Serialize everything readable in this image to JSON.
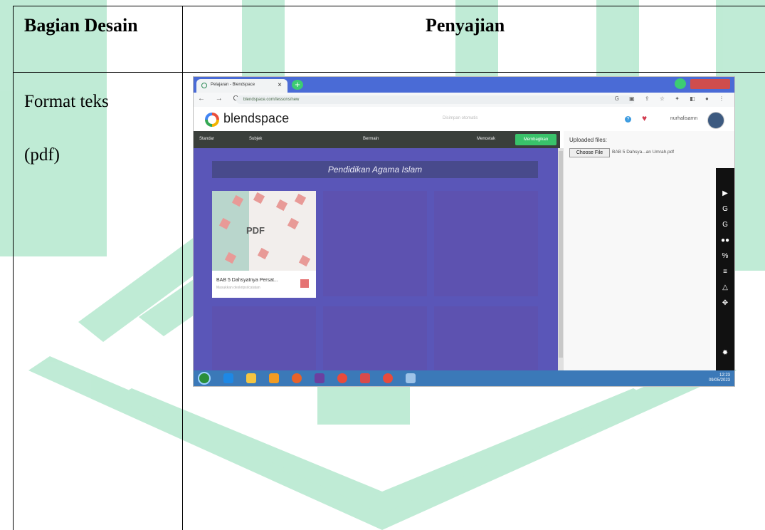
{
  "table": {
    "headers": [
      "Bagian Desain",
      "Penyajian"
    ],
    "row": {
      "col1_line1": "Format teks",
      "col1_line2": "(pdf)"
    }
  },
  "screenshot": {
    "browser": {
      "tab_title": "Pelajaran - Blendspace",
      "url": "blendspace.com/lessons/new",
      "nav_icons": "← → C"
    },
    "blendspace": {
      "logo": "blendspace",
      "saved_status": "Disimpan otomatis",
      "username": "nurhalisamn",
      "toolbar": {
        "standar": "Standar",
        "subjek": "Subjek",
        "bermain": "Bermain",
        "mencetak": "Mencetak",
        "membagikan": "Membagikan"
      },
      "lesson_title": "Pendidikan Agama Islam",
      "card": {
        "badge": "PDF",
        "title": "BAB 5 Dahsyatnya Persat...",
        "subtitle": "Masukkan deskripsi/catatan"
      },
      "upload": {
        "label": "Uploaded files:",
        "button": "Choose File",
        "file": "BAB 5 Dahsya...an Umrah.pdf"
      }
    },
    "taskbar": {
      "time": "12:23",
      "date": "09/05/2023"
    }
  },
  "colors": {
    "watermark_green": "#27b46a",
    "canvas_purple": "#5a56b8",
    "share_green": "#39c26a"
  }
}
